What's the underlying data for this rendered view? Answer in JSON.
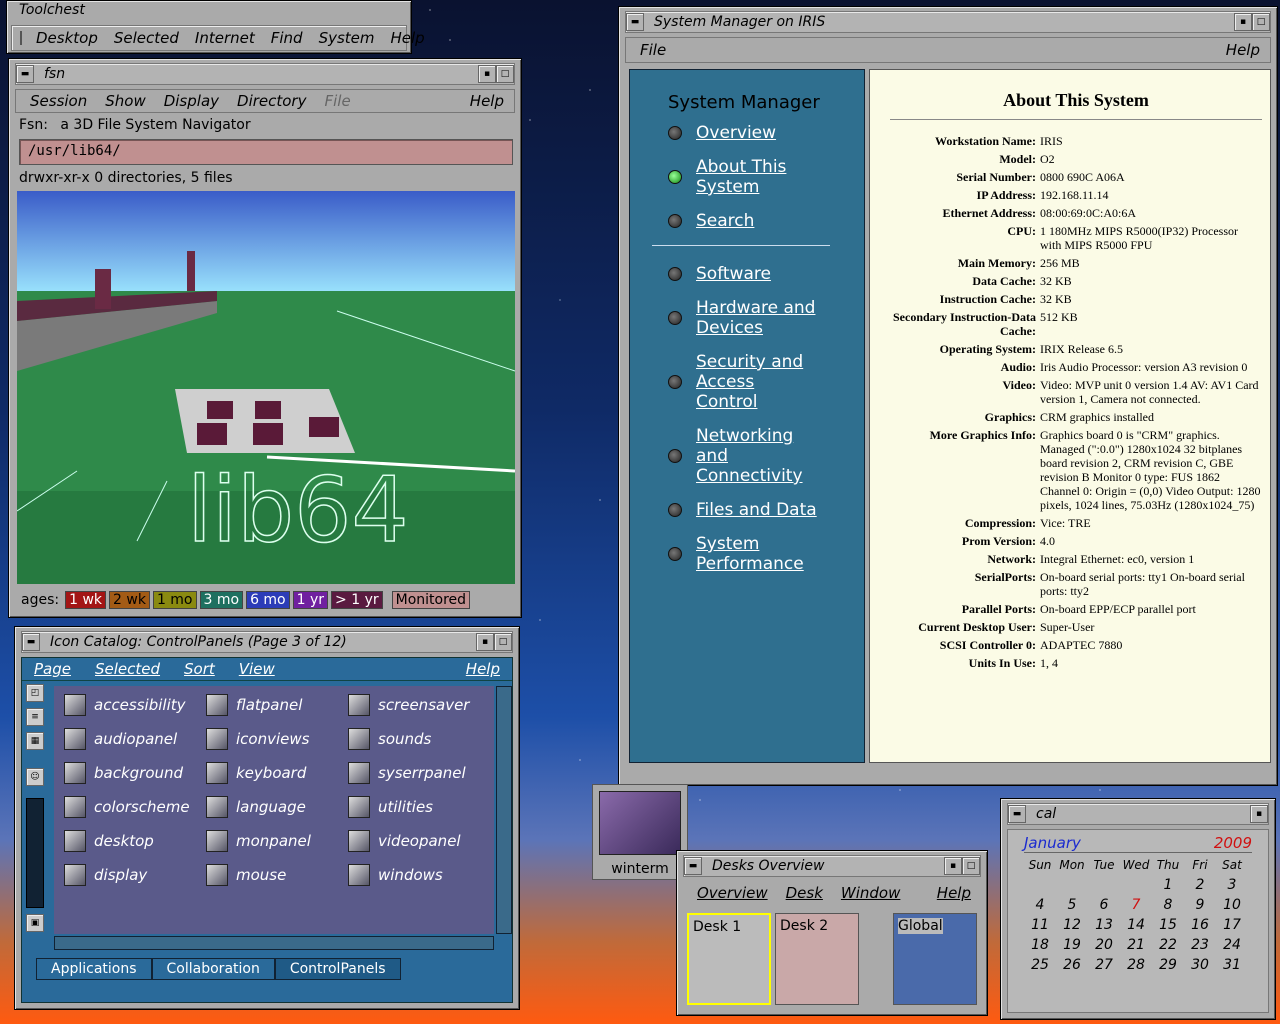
{
  "toolchest": {
    "title": "Toolchest",
    "menu": [
      "Desktop",
      "Selected",
      "Internet",
      "Find",
      "System",
      "Help"
    ]
  },
  "fsn": {
    "title": "fsn",
    "menu": [
      "Session",
      "Show",
      "Display",
      "Directory",
      "File",
      "Help"
    ],
    "app_label": "Fsn:",
    "app_desc": "a 3D File System Navigator",
    "path": "/usr/lib64/",
    "status": "drwxr-xr-x 0 directories, 5 files",
    "ages_label": "ages:",
    "ages": [
      {
        "label": "1 wk",
        "color": "#a31515"
      },
      {
        "label": "2 wk",
        "color": "#a35b15"
      },
      {
        "label": "1 mo",
        "color": "#8a8a10"
      },
      {
        "label": "3 mo",
        "color": "#1e7060"
      },
      {
        "label": "6 mo",
        "color": "#2c3cb8"
      },
      {
        "label": "1 yr",
        "color": "#7020a0"
      },
      {
        "label": "> 1 yr",
        "color": "#5a1a40"
      }
    ],
    "monitored": "Monitored",
    "scene_text": "lib64"
  },
  "sysman": {
    "title": "System Manager on IRIS",
    "menu_file": "File",
    "menu_help": "Help",
    "nav_title": "System Manager",
    "nav": [
      "Overview",
      "About This System",
      "Search",
      "Software",
      "Hardware and Devices",
      "Security and Access Control",
      "Networking and Connectivity",
      "Files and Data",
      "System Performance"
    ],
    "active_nav": "About This System",
    "heading": "About This System",
    "info": [
      {
        "k": "Workstation Name:",
        "v": "IRIS"
      },
      {
        "k": "Model:",
        "v": "O2"
      },
      {
        "k": "Serial Number:",
        "v": "0800 690C A06A"
      },
      {
        "k": "IP Address:",
        "v": "192.168.11.14"
      },
      {
        "k": "Ethernet Address:",
        "v": "08:00:69:0C:A0:6A"
      },
      {
        "k": "CPU:",
        "v": "1 180MHz MIPS R5000(IP32) Processor with MIPS R5000 FPU"
      },
      {
        "k": "Main Memory:",
        "v": "256 MB"
      },
      {
        "k": "Data Cache:",
        "v": "32 KB"
      },
      {
        "k": "Instruction Cache:",
        "v": "32 KB"
      },
      {
        "k": "Secondary Instruction-Data Cache:",
        "v": "512 KB"
      },
      {
        "k": "Operating System:",
        "v": "IRIX Release 6.5"
      },
      {
        "k": "Audio:",
        "v": "Iris Audio Processor: version A3 revision 0"
      },
      {
        "k": "Video:",
        "v": "Video: MVP unit 0 version 1.4 AV: AV1 Card version 1, Camera not connected."
      },
      {
        "k": "Graphics:",
        "v": "CRM graphics installed"
      },
      {
        "k": "More Graphics Info:",
        "v": "Graphics board 0 is \"CRM\" graphics. Managed (\":0.0\") 1280x1024 32 bitplanes board revision 2, CRM revision C, GBE revision B Monitor 0 type: FUS 1862 Channel 0: Origin = (0,0) Video Output: 1280 pixels, 1024 lines, 75.03Hz (1280x1024_75)"
      },
      {
        "k": "Compression:",
        "v": "Vice: TRE"
      },
      {
        "k": "Prom Version:",
        "v": "4.0"
      },
      {
        "k": "Network:",
        "v": "Integral Ethernet: ec0, version 1"
      },
      {
        "k": "SerialPorts:",
        "v": "On-board serial ports: tty1 On-board serial ports: tty2"
      },
      {
        "k": "Parallel Ports:",
        "v": "On-board EPP/ECP parallel port"
      },
      {
        "k": "Current Desktop User:",
        "v": "Super-User"
      },
      {
        "k": "SCSI Controller 0:",
        "v": "ADAPTEC 7880"
      },
      {
        "k": "Units In Use:",
        "v": "1, 4"
      }
    ]
  },
  "iconcat": {
    "title": "Icon Catalog: ControlPanels (Page 3 of 12)",
    "menu": [
      "Page",
      "Selected",
      "Sort",
      "View",
      "Help"
    ],
    "items": [
      "accessibility",
      "audiopanel",
      "background",
      "colorscheme",
      "desktop",
      "display",
      "flatpanel",
      "iconviews",
      "keyboard",
      "language",
      "monpanel",
      "mouse",
      "screensaver",
      "sounds",
      "syserrpanel",
      "utilities",
      "videopanel",
      "windows"
    ],
    "tabs": [
      "Applications",
      "Collaboration",
      "ControlPanels"
    ]
  },
  "winterm": {
    "label": "winterm"
  },
  "desks": {
    "title": "Desks Overview",
    "menu": [
      "Overview",
      "Desk",
      "Window",
      "Help"
    ],
    "desks": [
      "Desk 1",
      "Desk 2",
      "Global"
    ]
  },
  "cal": {
    "title": "cal",
    "month": "January",
    "year": "2009",
    "weekdays": [
      "Sun",
      "Mon",
      "Tue",
      "Wed",
      "Thu",
      "Fri",
      "Sat"
    ],
    "today": "7",
    "weeks": [
      [
        "",
        "",
        "",
        "",
        "1",
        "2",
        "3"
      ],
      [
        "4",
        "5",
        "6",
        "7",
        "8",
        "9",
        "10"
      ],
      [
        "11",
        "12",
        "13",
        "14",
        "15",
        "16",
        "17"
      ],
      [
        "18",
        "19",
        "20",
        "21",
        "22",
        "23",
        "24"
      ],
      [
        "25",
        "26",
        "27",
        "28",
        "29",
        "30",
        "31"
      ]
    ]
  }
}
